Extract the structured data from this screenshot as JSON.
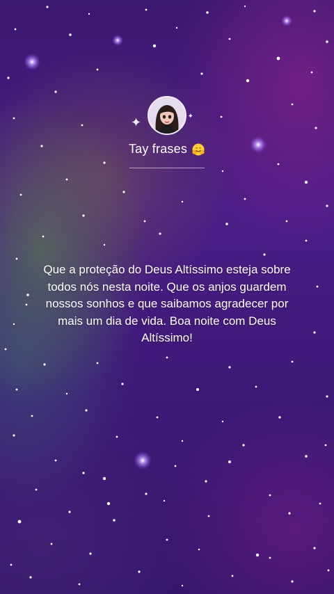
{
  "profile": {
    "avatar_icon": "woman-avatar-icon",
    "sparkle_icon": "sparkle-icon",
    "name": "Tay frases",
    "name_emoji_icon": "hugging-face-emoji-icon"
  },
  "quote": {
    "text": "Que a proteção do Deus Altíssimo esteja sobre todos nós nesta noite. Que os anjos guardem nossos sonhos e que saibamos agradecer por mais um dia de vida. Boa noite com Deus Altíssimo!"
  },
  "theme": {
    "background_primary": "#4a1d86",
    "background_secondary": "#3b1870",
    "text_color": "#ffffff"
  }
}
